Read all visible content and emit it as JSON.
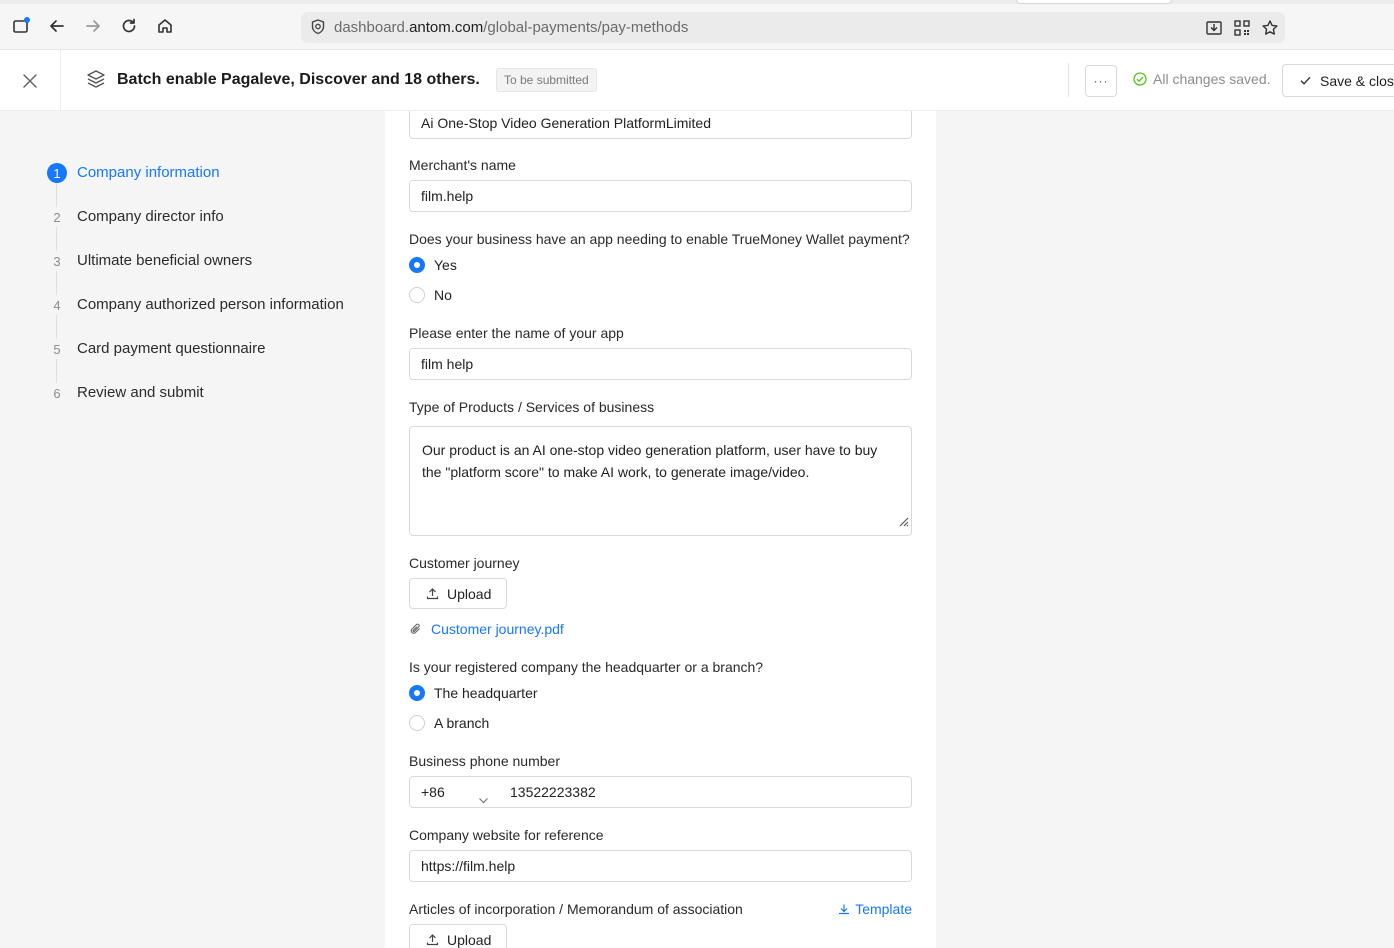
{
  "browser": {
    "url_prefix": "dashboard.",
    "url_domain": "antom.com",
    "url_path": "/global-payments/pay-methods"
  },
  "header": {
    "title": "Batch enable Pagaleve, Discover and 18 others.",
    "status_tag": "To be submitted",
    "more_label": "···",
    "saved_text": "All changes saved.",
    "save_close_label": "Save & close"
  },
  "steps": [
    {
      "num": "1",
      "label": "Company information",
      "active": true
    },
    {
      "num": "2",
      "label": "Company director info",
      "active": false
    },
    {
      "num": "3",
      "label": "Ultimate beneficial owners",
      "active": false
    },
    {
      "num": "4",
      "label": "Company authorized person information",
      "active": false
    },
    {
      "num": "5",
      "label": "Card payment questionnaire",
      "active": false
    },
    {
      "num": "6",
      "label": "Review and submit",
      "active": false
    }
  ],
  "form": {
    "company_name_value": "Ai One-Stop Video Generation PlatformLimited",
    "merchant_name_label": "Merchant's name",
    "merchant_name_value": "film.help",
    "app_question_label": "Does your business have an app needing to enable TrueMoney Wallet payment?",
    "app_yes": "Yes",
    "app_no": "No",
    "app_name_label": "Please enter the name of your app",
    "app_name_value": "film help",
    "products_label": "Type of Products / Services of business",
    "products_value": "Our product is an AI one-stop video generation platform, user have to buy the \"platform score\" to make AI work, to generate image/video.",
    "journey_label": "Customer journey",
    "upload_label": "Upload",
    "journey_file": "Customer journey.pdf",
    "hq_question_label": "Is your registered company the headquarter or a branch?",
    "hq_option": "The headquarter",
    "branch_option": "A branch",
    "phone_label": "Business phone number",
    "phone_prefix": "+86",
    "phone_value": "13522223382",
    "website_label": "Company website for reference",
    "website_value": "https://film.help",
    "articles_label": "Articles of incorporation / Memorandum of association",
    "template_label": "Template",
    "articles_upload_label": "Upload"
  },
  "colors": {
    "accent": "#1677ff",
    "success": "#52c41a"
  }
}
